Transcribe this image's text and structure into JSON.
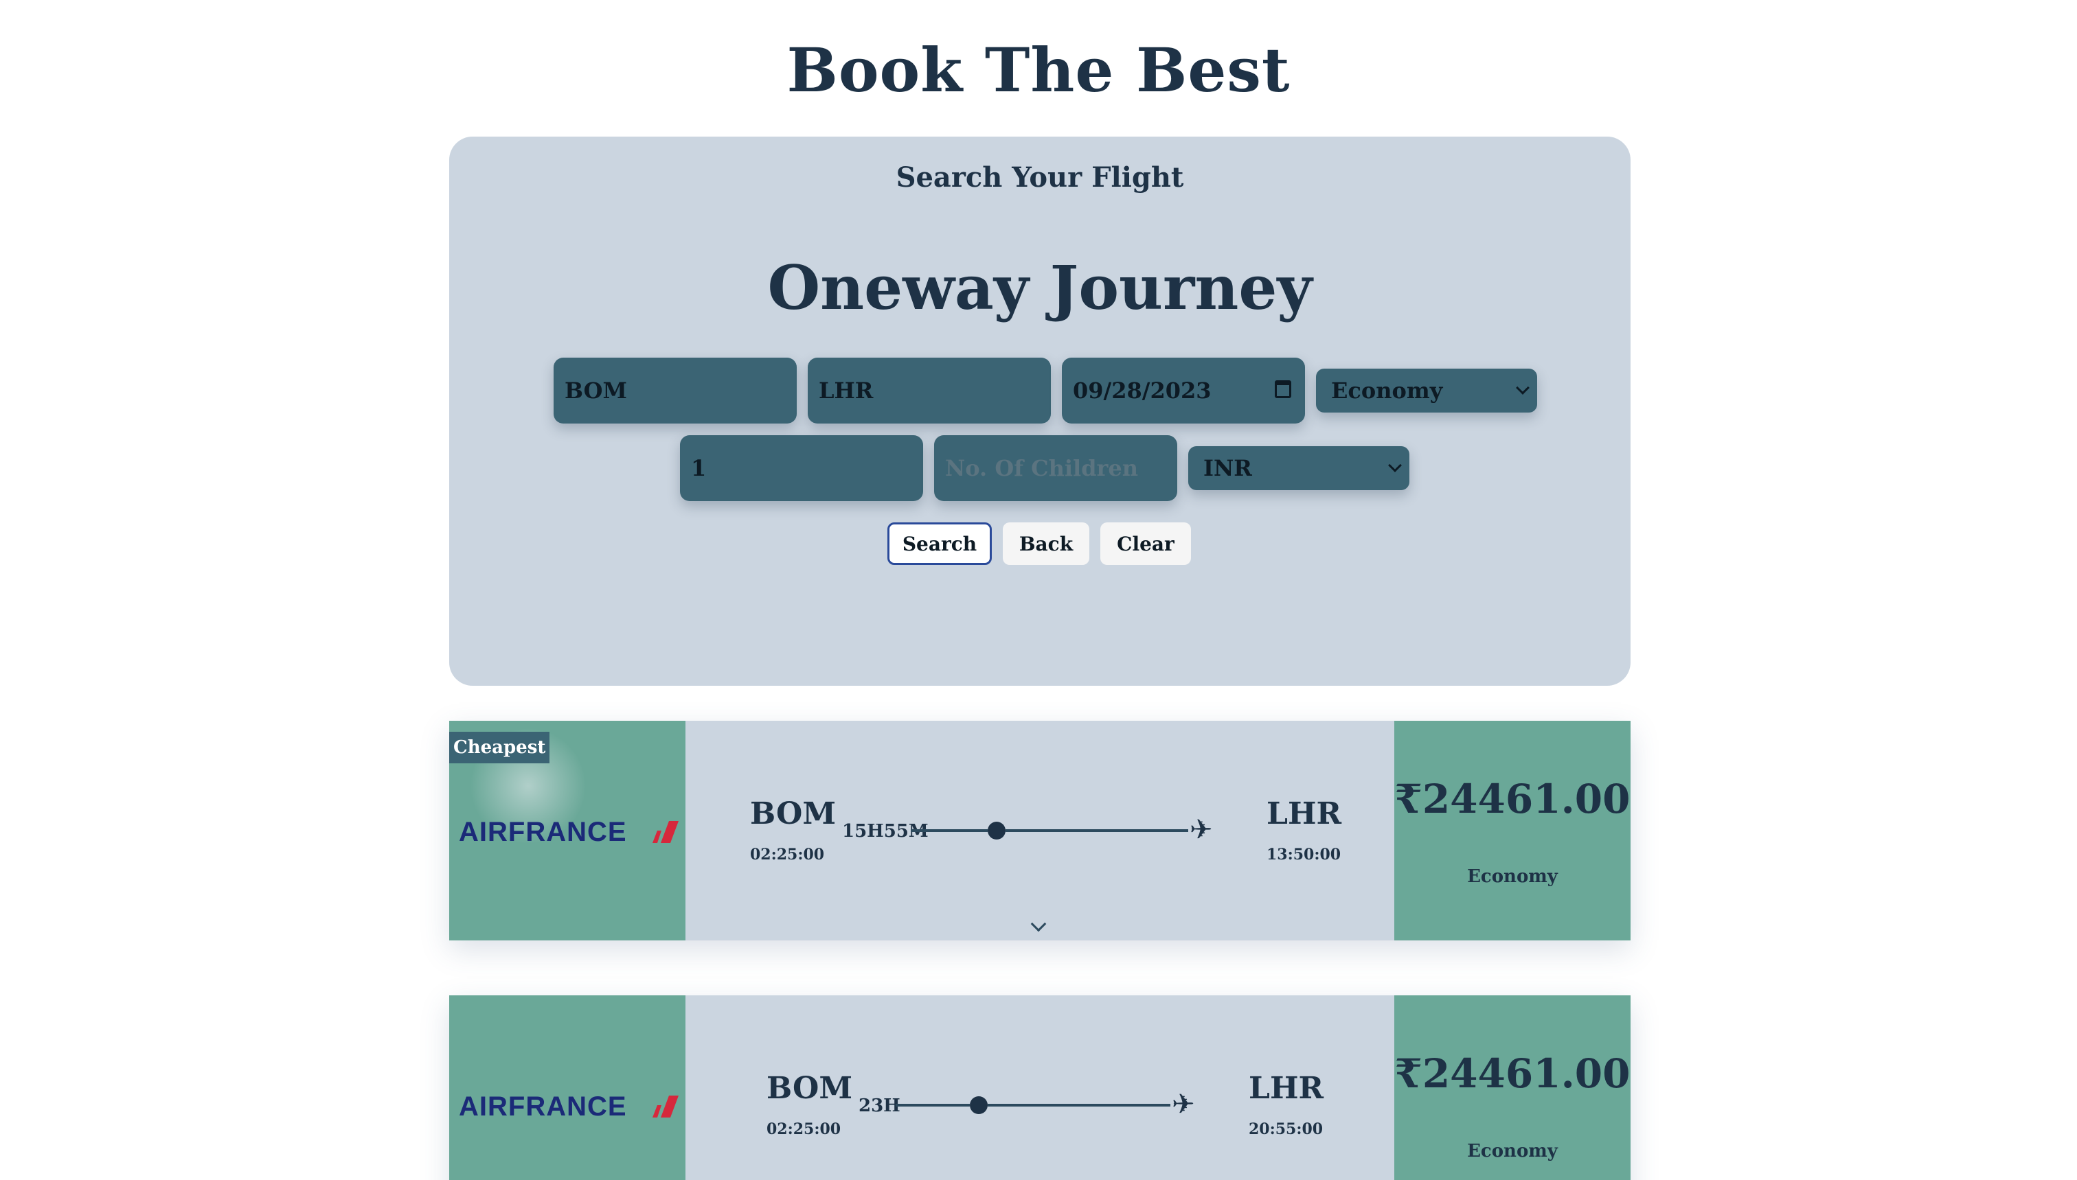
{
  "page_title": "Book The Best",
  "search": {
    "heading": "Search Your Flight",
    "journey_title": "Oneway Journey",
    "from": "BOM",
    "to": "LHR",
    "date": "09/28/2023",
    "class_selected": "Economy",
    "adults": "1",
    "children_placeholder": "No. Of Children",
    "currency_selected": "INR",
    "buttons": {
      "search": "Search",
      "back": "Back",
      "clear": "Clear"
    }
  },
  "results": [
    {
      "badge": "Cheapest",
      "airline": "AIRFRANCE",
      "from_code": "BOM",
      "departure_time": "02:25:00",
      "duration": "15H55M",
      "to_code": "LHR",
      "arrival_time": "13:50:00",
      "price": "₹24461.00",
      "cabin": "Economy"
    },
    {
      "badge": "",
      "airline": "AIRFRANCE",
      "from_code": "BOM",
      "departure_time": "02:25:00",
      "duration": "23H",
      "to_code": "LHR",
      "arrival_time": "20:55:00",
      "price": "₹24461.00",
      "cabin": "Economy"
    }
  ],
  "colors": {
    "title": "#1e3246",
    "panel_bg": "#cbd5e0",
    "field_bg": "#3b6474",
    "card_accent": "#6aa898",
    "airline_blue": "#1b2a78",
    "airline_red": "#d6283c",
    "active_button_border": "#2a4a9a"
  },
  "icons": {
    "date_field": "calendar-icon",
    "dropdown": "chevron-down-icon",
    "flight_end": "airplane-icon",
    "expand_details": "chevron-down-icon"
  }
}
